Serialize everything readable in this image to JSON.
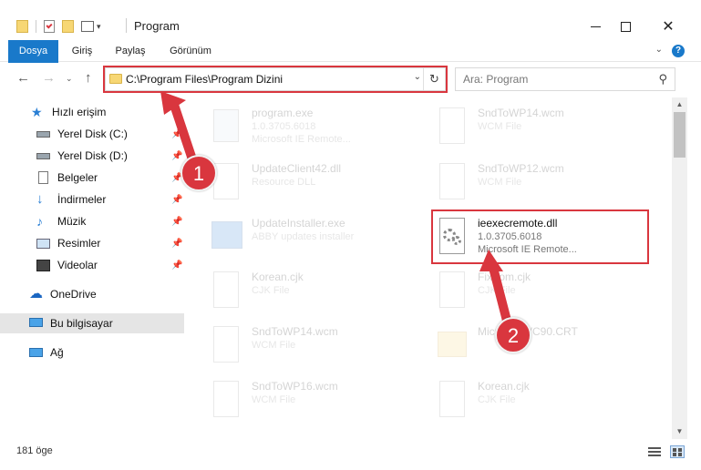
{
  "window": {
    "title": "Program",
    "minimize_icon": "minimize-icon",
    "maximize_icon": "maximize-icon",
    "close_icon": "close-icon"
  },
  "ribbon": {
    "tabs": [
      {
        "label": "Dosya"
      },
      {
        "label": "Giriş"
      },
      {
        "label": "Paylaş"
      },
      {
        "label": "Görünüm"
      }
    ],
    "help_label": "?"
  },
  "nav": {
    "address": "C:\\Program Files\\Program Dizini",
    "search_placeholder": "Ara: Program"
  },
  "sidebar": {
    "quick_access": "Hızlı erişim",
    "items": [
      {
        "label": "Yerel Disk (C:)"
      },
      {
        "label": "Yerel Disk (D:)"
      },
      {
        "label": "Belgeler"
      },
      {
        "label": "İndirmeler"
      },
      {
        "label": "Müzik"
      },
      {
        "label": "Resimler"
      },
      {
        "label": "Videolar"
      }
    ],
    "onedrive": "OneDrive",
    "this_pc": "Bu bilgisayar",
    "network": "Ağ"
  },
  "files": [
    {
      "name": "program.exe",
      "line1": "1.0.3705.6018",
      "line2": "Microsoft IE Remote..."
    },
    {
      "name": "SndToWP14.wcm",
      "line1": "WCM File",
      "line2": ""
    },
    {
      "name": "UpdateClient42.dll",
      "line1": "Resource DLL",
      "line2": ""
    },
    {
      "name": "SndToWP12.wcm",
      "line1": "WCM File",
      "line2": ""
    },
    {
      "name": "UpdateInstaller.exe",
      "line1": "ABBY updates installer",
      "line2": ""
    },
    {
      "name": "ieexecremote.dll",
      "line1": "1.0.3705.6018",
      "line2": "Microsoft IE Remote..."
    },
    {
      "name": "Korean.cjk",
      "line1": "CJK File",
      "line2": ""
    },
    {
      "name": "Fixtrom.cjk",
      "line1": "CJK File",
      "line2": ""
    },
    {
      "name": "SndToWP14.wcm",
      "line1": "WCM File",
      "line2": ""
    },
    {
      "name": "Microsoft.VC90.CRT",
      "line1": "",
      "line2": ""
    },
    {
      "name": "SndToWP16.wcm",
      "line1": "WCM File",
      "line2": ""
    },
    {
      "name": "Korean.cjk",
      "line1": "CJK File",
      "line2": ""
    }
  ],
  "status": {
    "count": "181 öge"
  },
  "markers": {
    "step1": "1",
    "step2": "2"
  },
  "colors": {
    "accent": "#1979ca",
    "annotation": "#d9363e"
  }
}
